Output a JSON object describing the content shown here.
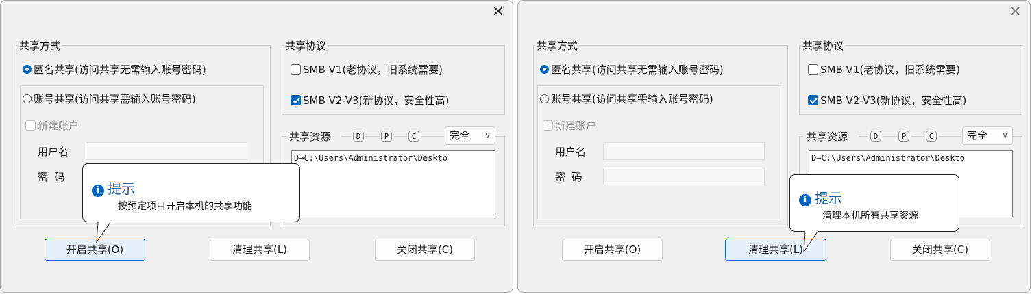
{
  "dialogs": [
    {
      "close_glyph": "✕",
      "share_mode": {
        "legend": "共享方式",
        "anonymous_label": "匿名共享(访问共享无需输入账号密码)",
        "account_label": "账号共享(访问共享需输入账号密码)",
        "new_account_label": "新建账户",
        "username_label": "用户名",
        "password_label": "密  码"
      },
      "protocol": {
        "legend": "共享协议",
        "smb_v1_label": "SMB V1(老协议，旧系统需要)",
        "smb_v2_label": "SMB V2-V3(新协议，安全性高)"
      },
      "resources": {
        "legend": "共享资源",
        "letters": [
          "D",
          "P",
          "C"
        ],
        "permission": "完全",
        "items": [
          "D→C:\\Users\\Administrator\\Deskto"
        ]
      },
      "buttons": {
        "start": "开启共享(O)",
        "clean": "清理共享(L)",
        "close": "关闭共享(C)"
      },
      "tooltip": {
        "title": "提示",
        "body": "按预定项目开启本机的共享功能"
      }
    },
    {
      "close_glyph": "✕",
      "share_mode": {
        "legend": "共享方式",
        "anonymous_label": "匿名共享(访问共享无需输入账号密码)",
        "account_label": "账号共享(访问共享需输入账号密码)",
        "new_account_label": "新建账户",
        "username_label": "用户名",
        "password_label": "密  码"
      },
      "protocol": {
        "legend": "共享协议",
        "smb_v1_label": "SMB V1(老协议，旧系统需要)",
        "smb_v2_label": "SMB V2-V3(新协议，安全性高)"
      },
      "resources": {
        "legend": "共享资源",
        "letters": [
          "D",
          "P",
          "C"
        ],
        "permission": "完全",
        "items": [
          "D→C:\\Users\\Administrator\\Deskto"
        ]
      },
      "buttons": {
        "start": "开启共享(O)",
        "clean": "清理共享(L)",
        "close": "关闭共享(C)"
      },
      "tooltip": {
        "title": "提示",
        "body": "清理本机所有共享资源"
      }
    }
  ],
  "colors": {
    "accent": "#0067c0",
    "tooltip_title": "#1f5fa8"
  },
  "icons": {
    "info": "info-icon",
    "close": "close-icon",
    "chevron": "chevron-down-icon"
  }
}
